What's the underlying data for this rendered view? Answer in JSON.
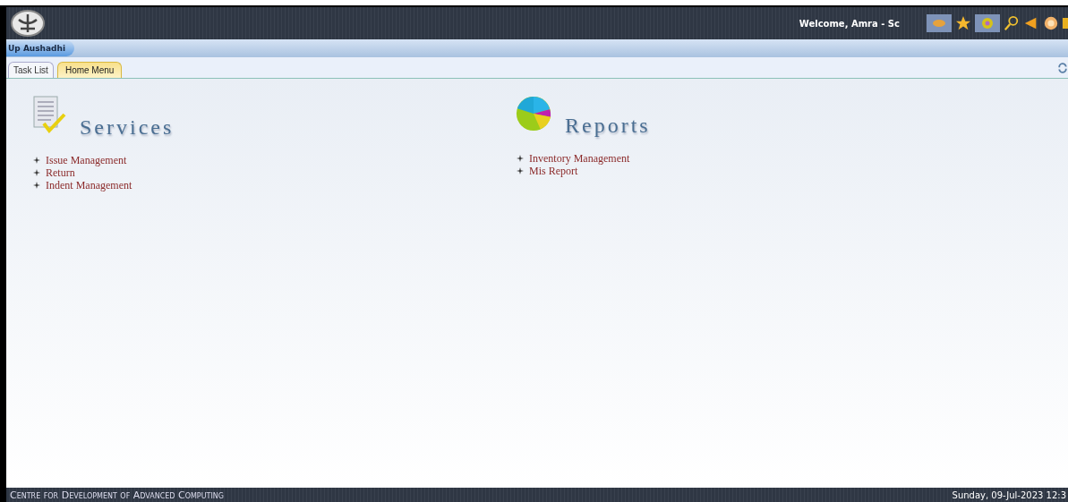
{
  "header": {
    "welcome": "Welcome, Amra - Sc"
  },
  "app_bar": {
    "title": "Up Aushadhi"
  },
  "tabs": [
    {
      "label": "Task List",
      "selected": false
    },
    {
      "label": "Home Menu",
      "selected": true
    }
  ],
  "sections": [
    {
      "title": "Services",
      "kind": "services",
      "items": [
        "Issue Management",
        "Return",
        "Indent Management"
      ]
    },
    {
      "title": "Reports",
      "kind": "reports",
      "items": [
        "Inventory Management",
        "Mis Report"
      ]
    }
  ],
  "footer": {
    "organisation": "Centre for Development of Advanced Computing",
    "datetime": "Sunday, 09-Jul-2023 12:3"
  }
}
